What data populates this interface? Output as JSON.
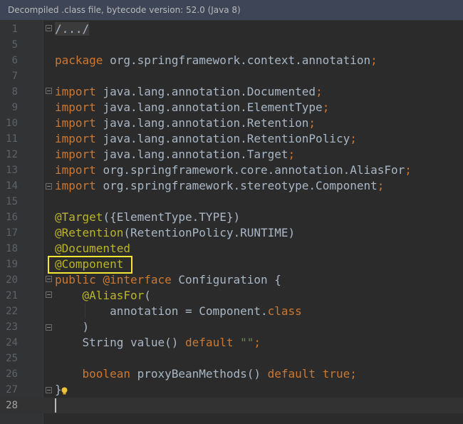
{
  "banner": {
    "text": "Decompiled .class file, bytecode version: 52.0 (Java 8)"
  },
  "editor": {
    "current_line": 28,
    "highlighted_line": 19,
    "lines": [
      {
        "n": "1",
        "fold": "start",
        "tokens": [
          {
            "t": "/.../",
            "c": "fold-dim"
          }
        ]
      },
      {
        "n": "5",
        "tokens": []
      },
      {
        "n": "6",
        "tokens": [
          {
            "t": "package ",
            "c": "kw"
          },
          {
            "t": "org.springframework.context.annotation",
            "c": "p"
          },
          {
            "t": ";",
            "c": "kw"
          }
        ]
      },
      {
        "n": "7",
        "tokens": []
      },
      {
        "n": "8",
        "fold": "start",
        "tokens": [
          {
            "t": "import ",
            "c": "kw"
          },
          {
            "t": "java.lang.annotation.Documented",
            "c": "p"
          },
          {
            "t": ";",
            "c": "kw"
          }
        ]
      },
      {
        "n": "9",
        "tokens": [
          {
            "t": "import ",
            "c": "kw"
          },
          {
            "t": "java.lang.annotation.ElementType",
            "c": "p"
          },
          {
            "t": ";",
            "c": "kw"
          }
        ]
      },
      {
        "n": "10",
        "tokens": [
          {
            "t": "import ",
            "c": "kw"
          },
          {
            "t": "java.lang.annotation.Retention",
            "c": "p"
          },
          {
            "t": ";",
            "c": "kw"
          }
        ]
      },
      {
        "n": "11",
        "tokens": [
          {
            "t": "import ",
            "c": "kw"
          },
          {
            "t": "java.lang.annotation.RetentionPolicy",
            "c": "p"
          },
          {
            "t": ";",
            "c": "kw"
          }
        ]
      },
      {
        "n": "12",
        "tokens": [
          {
            "t": "import ",
            "c": "kw"
          },
          {
            "t": "java.lang.annotation.Target",
            "c": "p"
          },
          {
            "t": ";",
            "c": "kw"
          }
        ]
      },
      {
        "n": "13",
        "tokens": [
          {
            "t": "import ",
            "c": "kw"
          },
          {
            "t": "org.springframework.core.annotation.AliasFor",
            "c": "p"
          },
          {
            "t": ";",
            "c": "kw"
          }
        ]
      },
      {
        "n": "14",
        "fold": "end",
        "tokens": [
          {
            "t": "import ",
            "c": "kw"
          },
          {
            "t": "org.springframework.stereotype.Component",
            "c": "p"
          },
          {
            "t": ";",
            "c": "kw"
          }
        ]
      },
      {
        "n": "15",
        "tokens": []
      },
      {
        "n": "16",
        "tokens": [
          {
            "t": "@Target",
            "c": "an"
          },
          {
            "t": "({ElementType.TYPE})",
            "c": "p"
          }
        ]
      },
      {
        "n": "17",
        "tokens": [
          {
            "t": "@Retention",
            "c": "an"
          },
          {
            "t": "(RetentionPolicy.RUNTIME)",
            "c": "p"
          }
        ]
      },
      {
        "n": "18",
        "tokens": [
          {
            "t": "@Documented",
            "c": "an"
          }
        ]
      },
      {
        "n": "19",
        "tokens": [
          {
            "t": "@Component",
            "c": "an"
          }
        ]
      },
      {
        "n": "20",
        "fold": "start",
        "tokens": [
          {
            "t": "public ",
            "c": "kw"
          },
          {
            "t": "@interface ",
            "c": "kw"
          },
          {
            "t": "Configuration {",
            "c": "p"
          }
        ]
      },
      {
        "n": "21",
        "fold": "start",
        "tokens": [
          {
            "t": "    ",
            "c": "p"
          },
          {
            "t": "@AliasFor",
            "c": "an"
          },
          {
            "t": "(",
            "c": "p"
          }
        ]
      },
      {
        "n": "22",
        "tokens": [
          {
            "t": "        annotation = Component.",
            "c": "p"
          },
          {
            "t": "class",
            "c": "kw"
          }
        ]
      },
      {
        "n": "23",
        "fold": "end",
        "tokens": [
          {
            "t": "    )",
            "c": "p"
          }
        ]
      },
      {
        "n": "24",
        "tokens": [
          {
            "t": "    String value() ",
            "c": "p"
          },
          {
            "t": "default ",
            "c": "kw"
          },
          {
            "t": "\"\"",
            "c": "str"
          },
          {
            "t": ";",
            "c": "kw"
          }
        ]
      },
      {
        "n": "25",
        "tokens": []
      },
      {
        "n": "26",
        "tokens": [
          {
            "t": "    ",
            "c": "p"
          },
          {
            "t": "boolean ",
            "c": "kw"
          },
          {
            "t": "proxyBeanMethods() ",
            "c": "p"
          },
          {
            "t": "default ",
            "c": "kw"
          },
          {
            "t": "true",
            "c": "kw"
          },
          {
            "t": ";",
            "c": "kw"
          }
        ]
      },
      {
        "n": "27",
        "fold": "end",
        "tokens": [
          {
            "t": "}",
            "c": "p"
          }
        ]
      },
      {
        "n": "28",
        "tokens": []
      }
    ]
  },
  "icons": {
    "fold_marker": "fold-toggle-icon",
    "intention": "lightbulb-icon"
  },
  "colors": {
    "keyword": "#cc7832",
    "annotation": "#bbb529",
    "string": "#6a8759",
    "plain": "#a9b7c6",
    "highlight_box": "#f5e634",
    "intention_bulb": "#f0c33c"
  }
}
